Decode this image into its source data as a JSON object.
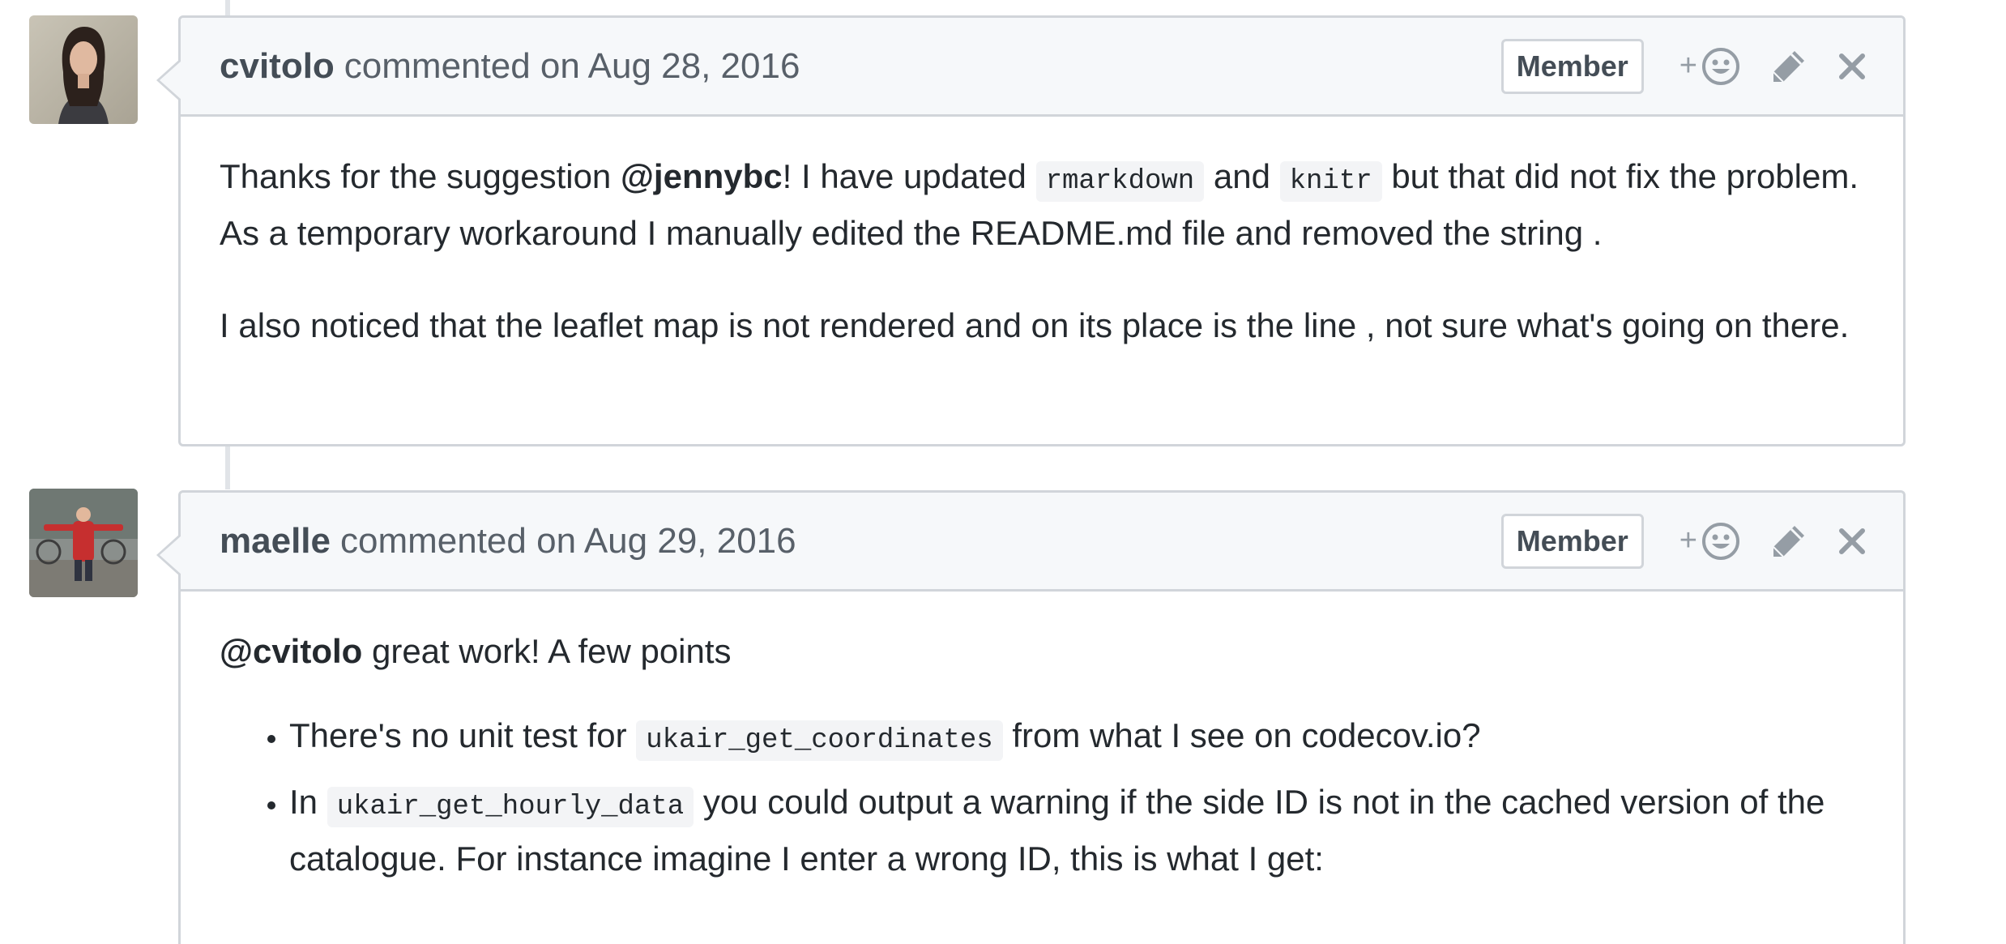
{
  "comments": [
    {
      "author": "cvitolo",
      "action": "commented on Aug 28, 2016",
      "badge": "Member",
      "add_reaction_label": "+",
      "body": {
        "p1": {
          "t1": "Thanks for the suggestion ",
          "mention": "@jennybc",
          "t2": "! I have updated ",
          "code1": "rmarkdown",
          "t3": " and ",
          "code2": "knitr",
          "t4": " but that did not fix the problem. As a temporary workaround I manually edited the README.md file and removed the string ."
        },
        "p2": "I also noticed that the leaflet map is not rendered and on its place is the line , not sure what's going on there."
      }
    },
    {
      "author": "maelle",
      "action": "commented on Aug 29, 2016",
      "badge": "Member",
      "add_reaction_label": "+",
      "body": {
        "p1": {
          "mention": "@cvitolo",
          "t1": " great work! A few points"
        },
        "bullets": [
          {
            "t1": "There's no unit test for ",
            "code": "ukair_get_coordinates",
            "t2": " from what I see on codecov.io?"
          },
          {
            "t1": "In ",
            "code": "ukair_get_hourly_data",
            "t2": " you could output a warning if the side ID is not in the cached version of the catalogue. For instance imagine I enter a wrong ID, this is what I get:"
          }
        ]
      }
    }
  ],
  "icons": [
    "smiley-icon",
    "pencil-icon",
    "close-icon"
  ],
  "colors": {
    "header_bg": "#f6f8fa",
    "border": "#d1d5da",
    "icon": "#959da5",
    "text": "#24292e"
  }
}
